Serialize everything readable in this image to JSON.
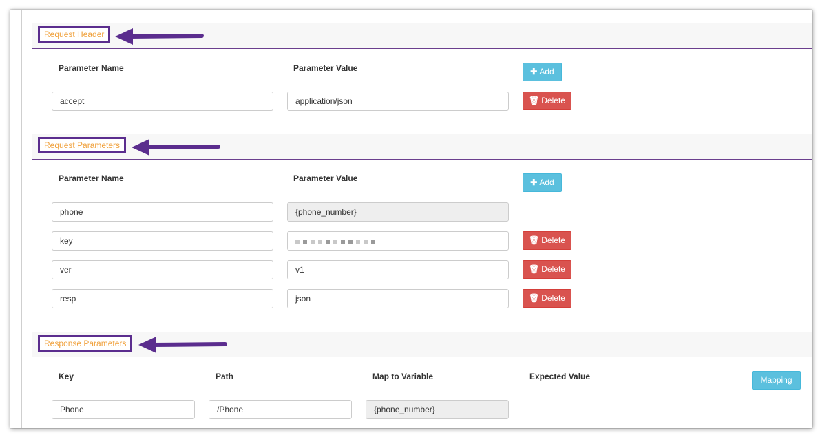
{
  "request_header": {
    "title": "Request Header",
    "col_name": "Parameter Name",
    "col_value": "Parameter Value",
    "add_label": "Add",
    "rows": [
      {
        "name": "accept",
        "value": "application/json",
        "delete_label": "Delete"
      }
    ]
  },
  "request_parameters": {
    "title": "Request Parameters",
    "col_name": "Parameter Name",
    "col_value": "Parameter Value",
    "add_label": "Add",
    "rows": [
      {
        "name": "phone",
        "value": "{phone_number}",
        "readonly": true
      },
      {
        "name": "key",
        "value": "",
        "obscured": true,
        "delete_label": "Delete"
      },
      {
        "name": "ver",
        "value": "v1",
        "delete_label": "Delete"
      },
      {
        "name": "resp",
        "value": "json",
        "delete_label": "Delete"
      }
    ]
  },
  "response_parameters": {
    "title": "Response Parameters",
    "col_key": "Key",
    "col_path": "Path",
    "col_map": "Map to Variable",
    "col_expected": "Expected Value",
    "mapping_label": "Mapping",
    "rows": [
      {
        "key": "Phone",
        "path": "/Phone",
        "map": "{phone_number}"
      }
    ]
  },
  "colors": {
    "accent_purple": "#5b2d8e",
    "title_orange": "#f0a03a",
    "add_blue": "#5bc0de",
    "delete_red": "#d9534f"
  },
  "icons": {
    "add": "plus-icon",
    "delete": "trash-icon"
  }
}
